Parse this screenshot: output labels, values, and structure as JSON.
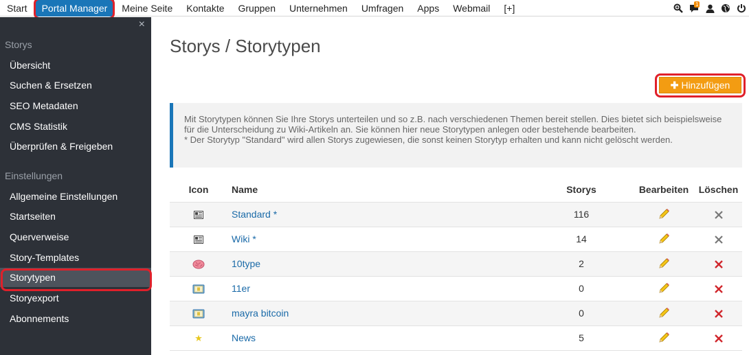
{
  "topnav": {
    "items": [
      "Start",
      "Portal Manager",
      "Meine Seite",
      "Kontakte",
      "Gruppen",
      "Unternehmen",
      "Umfragen",
      "Apps",
      "Webmail",
      "[+]"
    ],
    "notification_count": "1",
    "right_icons": [
      "search-icon",
      "chat-icon",
      "user-icon",
      "globe-icon",
      "power-icon"
    ]
  },
  "sidebar": {
    "section_storys": "Storys",
    "storys_items": [
      "Übersicht",
      "Suchen & Ersetzen",
      "SEO Metadaten",
      "CMS Statistik",
      "Überprüfen & Freigeben"
    ],
    "section_settings": "Einstellungen",
    "settings_items": [
      "Allgemeine Einstellungen",
      "Startseiten",
      "Querverweise",
      "Story-Templates",
      "Storytypen",
      "Storyexport",
      "Abonnements"
    ],
    "active_item": "Storytypen",
    "close_glyph": "×"
  },
  "main": {
    "title": "Storys / Storytypen",
    "add_label": "Hinzufügen",
    "info_text": "Mit Storytypen können Sie Ihre Storys unterteilen und so z.B. nach verschiedenen Themen bereit stellen. Dies bietet sich beispielsweise für die Unterscheidung zu Wiki-Artikeln an. Sie können hier neue Storytypen anlegen oder bestehende bearbeiten.",
    "info_note": "* Der Storytyp \"Standard\" wird allen Storys zugewiesen, die sonst keinen Storytyp erhalten und kann nicht gelöscht werden.",
    "table": {
      "headers": {
        "icon": "Icon",
        "name": "Name",
        "storys": "Storys",
        "edit": "Bearbeiten",
        "delete": "Löschen"
      },
      "rows": [
        {
          "name": "Standard *",
          "storys": "116",
          "icon": "newspaper-icon",
          "deletable": false
        },
        {
          "name": "Wiki *",
          "storys": "14",
          "icon": "newspaper-icon",
          "deletable": false
        },
        {
          "name": "10type",
          "storys": "2",
          "icon": "brain-icon",
          "deletable": true
        },
        {
          "name": "11er",
          "storys": "0",
          "icon": "book-icon",
          "deletable": true
        },
        {
          "name": "mayra bitcoin",
          "storys": "0",
          "icon": "book-icon",
          "deletable": true
        },
        {
          "name": "News",
          "storys": "5",
          "icon": "star-icon",
          "deletable": true
        }
      ]
    }
  },
  "colors": {
    "accent_blue": "#1a76b8",
    "button_orange": "#f39c12",
    "highlight_red": "#e0202a",
    "delete_red": "#d0262c",
    "delete_disabled": "#777777",
    "sidebar_bg": "#2d3138"
  }
}
